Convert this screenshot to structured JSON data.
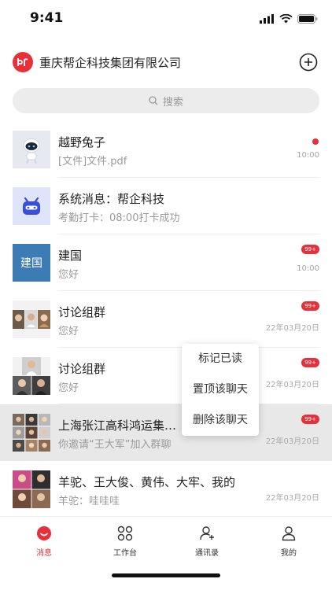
{
  "status": {
    "time": "9:41"
  },
  "org": {
    "name": "重庆帮企科技集团有限公司",
    "logo_text": "bR"
  },
  "search": {
    "placeholder": "搜索"
  },
  "chats": [
    {
      "title": "越野兔子",
      "preview": "[文件]文件.pdf",
      "time": "10:00",
      "indicator": "dot"
    },
    {
      "title": "系统消息：帮企科技",
      "preview": "考勤打卡：08:00打卡成功",
      "time": "",
      "indicator": ""
    },
    {
      "title": "建国",
      "avatar_text": "建国",
      "preview": "您好",
      "time": "10:00",
      "badge": "99+"
    },
    {
      "title": "讨论组群",
      "preview": "您好",
      "time": "22年03月20日",
      "badge": "99+"
    },
    {
      "title": "讨论组群",
      "preview": "您好",
      "time": "22年03月20日",
      "badge": "99+"
    },
    {
      "title": "上海张江高科鸿运集…",
      "preview": "你邀请“王大军”加入群聊",
      "time": "22年03月20日",
      "badge": "99+"
    },
    {
      "title": "羊驼、王大俊、黄伟、大牢、我的",
      "preview": "羊驼：哇哇哇",
      "time": "22年03月20日",
      "badge": ""
    }
  ],
  "context_menu": {
    "items": [
      "标记已读",
      "置顶该聊天",
      "删除该聊天"
    ]
  },
  "tabs": [
    {
      "label": "消息",
      "icon": "message-icon",
      "active": true
    },
    {
      "label": "工作台",
      "icon": "workbench-icon",
      "active": false
    },
    {
      "label": "通讯录",
      "icon": "contacts-icon",
      "active": false
    },
    {
      "label": "我的",
      "icon": "profile-icon",
      "active": false
    }
  ],
  "colors": {
    "accent": "#e8303a",
    "highlight_row": "#e8e8e8",
    "avatar_blue": "#3d7bb5"
  }
}
